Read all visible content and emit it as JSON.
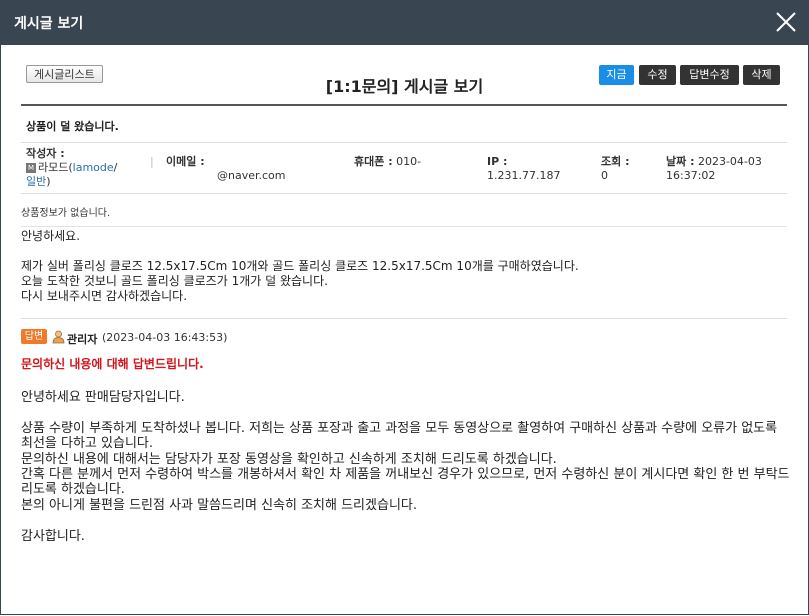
{
  "window": {
    "title": "게시글 보기"
  },
  "toolbar": {
    "list_button": "게시글리스트",
    "page_title": "[1:1문의] 게시글 보기",
    "now_button": "지금",
    "edit_button": "수정",
    "reply_edit_button": "답변수정",
    "delete_button": "삭제"
  },
  "post": {
    "subject": "상품이 덜 왔습니다.",
    "meta": {
      "author_label": "작성자 :",
      "author_name": "라모드(",
      "author_id": "lamode",
      "author_sep": "/",
      "author_grade": "일반",
      "author_close": ")",
      "member_icon_text": "M",
      "email_label": "이메일 :",
      "email_value": "@naver.com",
      "phone_label": "휴대폰 :",
      "phone_value": "010-",
      "ip_label": "IP :",
      "ip_value": "1.231.77.187",
      "views_label": "조회 :",
      "views_value": "0",
      "date_label": "날짜 :",
      "date_value": "2023-04-03",
      "time_value": "16:37:02"
    },
    "no_product": "상품정보가 없습니다.",
    "body": "안녕하세요.\n\n제가 실버 폴리싱 클로즈 12.5x17.5Cm 10개와 골드 폴리싱 클로즈 12.5x17.5Cm 10개를 구매하였습니다.\n오늘 도착한 것보니 골드 폴리싱 클로즈가 1개가 덜 왔습니다.\n다시 보내주시면 감사하겠습니다."
  },
  "reply": {
    "badge": "답변",
    "admin_name": "관리자",
    "date": "(2023-04-03 16:43:53)",
    "heading": "문의하신 내용에 대해 답변드립니다.",
    "body": "안녕하세요 판매담당자입니다.\n\n상품 수량이 부족하게 도착하셨나 봅니다. 저희는 상품 포장과 출고 과정을 모두 동영상으로 촬영하여 구매하신 상품과 수량에 오류가 없도록 최선을 다하고 있습니다.\n문의하신 내용에 대해서는 담당자가 포장 동영상을 확인하고 신속하게 조치해 드리도록 하겠습니다.\n간혹 다른 분께서 먼저 수령하여 박스를 개봉하셔서 확인 차 제품을 꺼내보신 경우가 있으므로, 먼저 수령하신 분이 계시다면 확인 한 번 부탁드리도록 하겠습니다.\n본의 아니게 불편을 드린점 사과 말씀드리며 신속히 조치해 드리겠습니다.\n\n감사합니다."
  },
  "colors": {
    "titlebar": "#3a4552",
    "now_button": "#1a8ee6",
    "badge": "#f07a2a",
    "heading": "#d4141c"
  }
}
